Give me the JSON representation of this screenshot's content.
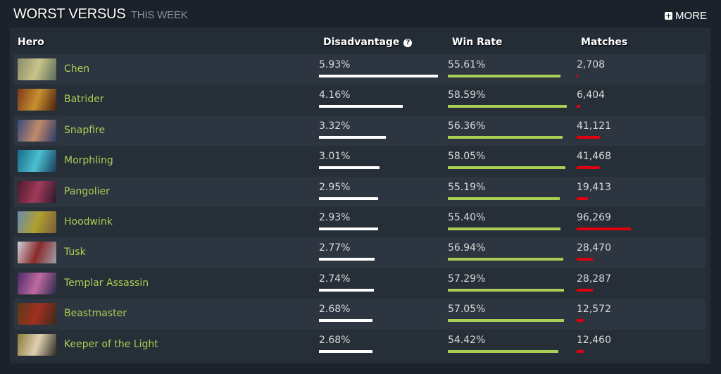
{
  "header": {
    "title": "WORST VERSUS",
    "subtitle": "THIS WEEK",
    "more_label": "MORE",
    "more_icon": "plus-square-icon"
  },
  "table": {
    "columns": {
      "hero": "Hero",
      "disadvantage": "Disadvantage",
      "disadvantage_help_icon": "?",
      "win_rate": "Win Rate",
      "matches": "Matches"
    },
    "colors": {
      "hero_link": "#a9cf54",
      "disadvantage_bar": "#ffffff",
      "win_rate_bar": "#a9cf54",
      "matches_bar": "#e1000f"
    },
    "rows": [
      {
        "hero": "Chen",
        "disadvantage": "5.93%",
        "disadvantage_value": 5.93,
        "win_rate": "55.61%",
        "win_rate_value": 55.61,
        "matches": "2,708",
        "matches_value": 2708,
        "portrait_colors": [
          "#8a8a6a",
          "#c9c58a",
          "#5a6a5a"
        ]
      },
      {
        "hero": "Batrider",
        "disadvantage": "4.16%",
        "disadvantage_value": 4.16,
        "win_rate": "58.59%",
        "win_rate_value": 58.59,
        "matches": "6,404",
        "matches_value": 6404,
        "portrait_colors": [
          "#7a3a1a",
          "#c89030",
          "#4a2010"
        ]
      },
      {
        "hero": "Snapfire",
        "disadvantage": "3.32%",
        "disadvantage_value": 3.32,
        "win_rate": "56.36%",
        "win_rate_value": 56.36,
        "matches": "41,121",
        "matches_value": 41121,
        "portrait_colors": [
          "#3a4a7a",
          "#c08a6a",
          "#2a3a6a"
        ]
      },
      {
        "hero": "Morphling",
        "disadvantage": "3.01%",
        "disadvantage_value": 3.01,
        "win_rate": "58.05%",
        "win_rate_value": 58.05,
        "matches": "41,468",
        "matches_value": 41468,
        "portrait_colors": [
          "#1a6a8a",
          "#4ac0d0",
          "#1a3a5a"
        ]
      },
      {
        "hero": "Pangolier",
        "disadvantage": "2.95%",
        "disadvantage_value": 2.95,
        "win_rate": "55.19%",
        "win_rate_value": 55.19,
        "matches": "19,413",
        "matches_value": 19413,
        "portrait_colors": [
          "#4a1a2a",
          "#a03a5a",
          "#2a1a2a"
        ]
      },
      {
        "hero": "Hoodwink",
        "disadvantage": "2.93%",
        "disadvantage_value": 2.93,
        "win_rate": "55.40%",
        "win_rate_value": 55.4,
        "matches": "96,269",
        "matches_value": 96269,
        "portrait_colors": [
          "#6a8ab0",
          "#b0a030",
          "#7a5a3a"
        ]
      },
      {
        "hero": "Tusk",
        "disadvantage": "2.77%",
        "disadvantage_value": 2.77,
        "win_rate": "56.94%",
        "win_rate_value": 56.94,
        "matches": "28,470",
        "matches_value": 28470,
        "portrait_colors": [
          "#d0d0d8",
          "#8a2a2a",
          "#a0a0a8"
        ]
      },
      {
        "hero": "Templar Assassin",
        "disadvantage": "2.74%",
        "disadvantage_value": 2.74,
        "win_rate": "57.29%",
        "win_rate_value": 57.29,
        "matches": "28,287",
        "matches_value": 28287,
        "portrait_colors": [
          "#4a2a6a",
          "#c06aa0",
          "#2a2a4a"
        ]
      },
      {
        "hero": "Beastmaster",
        "disadvantage": "2.68%",
        "disadvantage_value": 2.68,
        "win_rate": "57.05%",
        "win_rate_value": 57.05,
        "matches": "12,572",
        "matches_value": 12572,
        "portrait_colors": [
          "#5a3a1a",
          "#a03020",
          "#3a2a1a"
        ]
      },
      {
        "hero": "Keeper of the Light",
        "disadvantage": "2.68%",
        "disadvantage_value": 2.68,
        "win_rate": "54.42%",
        "win_rate_value": 54.42,
        "matches": "12,460",
        "matches_value": 12460,
        "portrait_colors": [
          "#8a7a3a",
          "#e0d0b0",
          "#2a2a20"
        ]
      }
    ]
  }
}
